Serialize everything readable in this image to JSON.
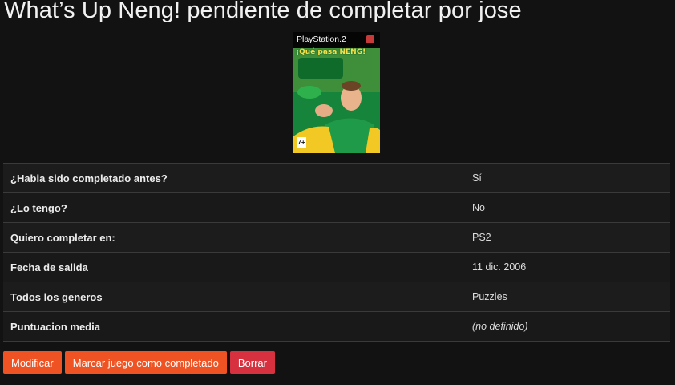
{
  "page": {
    "title": "What’s Up Neng! pendiente de completar por jose"
  },
  "cover": {
    "platform_label": "PlayStation.2",
    "logo_text": "¡Qué pasa NENG!",
    "age_rating": "7+",
    "colors": {
      "background": "#16843a",
      "jersey_yellow": "#f2c824",
      "jersey_green": "#1f9a48"
    }
  },
  "details": [
    {
      "label": "¿Habia sido completado antes?",
      "value": "Sí"
    },
    {
      "label": "¿Lo tengo?",
      "value": "No"
    },
    {
      "label": "Quiero completar en:",
      "value": "PS2"
    },
    {
      "label": "Fecha de salida",
      "value": "11 dic. 2006"
    },
    {
      "label": "Todos los generos",
      "value": "Puzzles"
    },
    {
      "label": "Puntuacion media",
      "value": "(no definido)",
      "undefined": true
    }
  ],
  "actions": {
    "modify_label": "Modificar",
    "mark_complete_label": "Marcar juego como completado",
    "delete_label": "Borrar"
  },
  "colors": {
    "accent_orange": "#ef5323",
    "danger_red": "#d7303f",
    "undefined_text": "#d9534f"
  }
}
